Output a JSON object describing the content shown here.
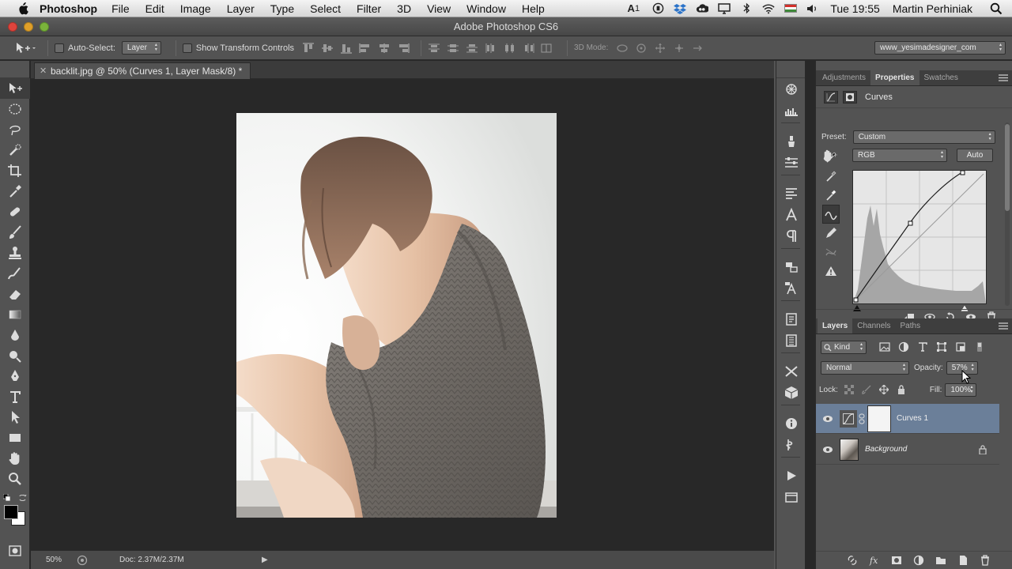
{
  "menubar": {
    "app": "Photoshop",
    "items": [
      "File",
      "Edit",
      "Image",
      "Layer",
      "Type",
      "Select",
      "Filter",
      "3D",
      "View",
      "Window",
      "Help"
    ],
    "input_badge": "1",
    "clock": "Tue 19:55",
    "user": "Martin Perhiniak"
  },
  "window": {
    "title": "Adobe Photoshop CS6"
  },
  "options_bar": {
    "auto_select_label": "Auto-Select:",
    "auto_select_value": "Layer",
    "transform_label": "Show Transform Controls",
    "mode_3d_label": "3D Mode:",
    "workspace": "www_yesimadesigner_com"
  },
  "document": {
    "tab_title": "backlit.jpg @ 50% (Curves 1, Layer Mask/8) *",
    "zoom": "50%",
    "doc_size": "Doc: 2.37M/2.37M"
  },
  "properties": {
    "tabs": [
      "Adjustments",
      "Properties",
      "Swatches"
    ],
    "active_tab": "Properties",
    "title": "Curves",
    "preset_label": "Preset:",
    "preset_value": "Custom",
    "channel_value": "RGB",
    "auto_label": "Auto"
  },
  "layers_panel": {
    "tabs": [
      "Layers",
      "Channels",
      "Paths"
    ],
    "active_tab": "Layers",
    "filter_label": "Kind",
    "blend_mode": "Normal",
    "opacity_label": "Opacity:",
    "opacity_value": "57%",
    "lock_label": "Lock:",
    "fill_label": "Fill:",
    "fill_value": "100%",
    "layers": [
      {
        "name": "Curves 1",
        "selected": true
      },
      {
        "name": "Background",
        "selected": false
      }
    ]
  },
  "colors": {
    "selection": "#6b7f99",
    "panel": "#535353",
    "canvas_bg": "#282828"
  }
}
